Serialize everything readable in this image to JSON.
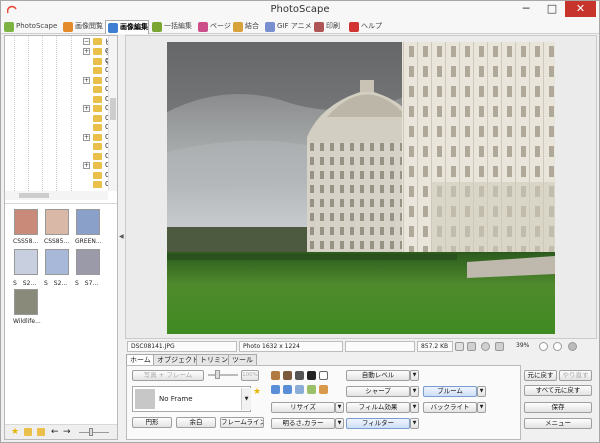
{
  "app": {
    "title": "PhotoScape",
    "minimize": "─",
    "maximize": "□",
    "close": "✕"
  },
  "tabs": [
    {
      "label": "PhotoScape",
      "color": "#7cb342"
    },
    {
      "label": "画像閲覧",
      "color": "#e58a2b"
    },
    {
      "label": "画像編集",
      "color": "#3f7fd3",
      "active": true
    },
    {
      "label": "一括編集",
      "color": "#7ba632"
    },
    {
      "label": "ページ",
      "color": "#cc4e8a"
    },
    {
      "label": "結合",
      "color": "#d8a23a"
    },
    {
      "label": "GIF アニメ",
      "color": "#7a8fd0"
    },
    {
      "label": "印刷",
      "color": "#b05555"
    },
    {
      "label": "ヘルプ",
      "color": "#d23333"
    }
  ],
  "tree": {
    "root_label": "ピクチ",
    "items": [
      "0",
      "0",
      "0",
      "0",
      "0",
      "0",
      "0",
      "0",
      "0",
      "0",
      "0",
      "0",
      "0",
      "0",
      "0"
    ]
  },
  "thumbnails": [
    {
      "caption": "CSS58..."
    },
    {
      "caption": "CSS85..."
    },
    {
      "caption": "GREEN..."
    },
    {
      "caption": "S　S2..."
    },
    {
      "caption": "S　S2..."
    },
    {
      "caption": "S　S7..."
    },
    {
      "caption": "Wildlife..."
    }
  ],
  "status": {
    "filename": "DSC08141.JPG",
    "dimensions": "Photo 1632 x 1224",
    "filesize": "857.2 KB",
    "zoom": "39%"
  },
  "panel": {
    "tabs": [
      "ホーム",
      "オブジェクト",
      "トリミング",
      "ツール"
    ],
    "frame_photo_button": "写真 + フレーム",
    "frame_percent": "100%",
    "frame_name": "No Frame",
    "shape_buttons": [
      "円形",
      "余白",
      "フレームライン"
    ],
    "auto_level": "自動レベル",
    "sharpen": "シャープ",
    "resize": "リサイズ",
    "film_effect": "フィルム効果",
    "brightness_color": "明るさ,カラー",
    "filter": "フィルター",
    "bloom": "ブルーム",
    "backlight": "バックライト"
  },
  "actions": {
    "undo": "元に戻す",
    "redo": "やり直す",
    "undo_all": "すべて元に戻す",
    "save": "保存",
    "menu": "メニュー"
  }
}
